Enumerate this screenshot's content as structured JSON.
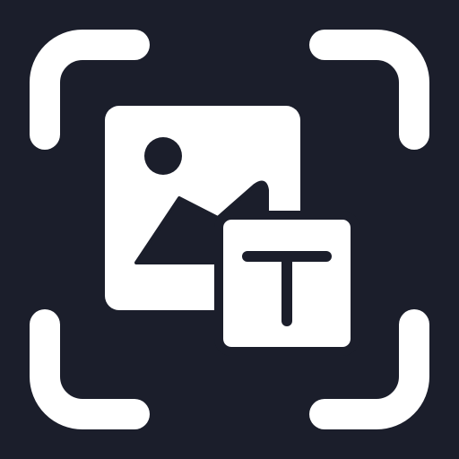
{
  "icon": {
    "background_color": "#1b1e2b",
    "foreground_color": "#ffffff",
    "glyphs": [
      "scan-frame-icon",
      "image-icon",
      "text-t-icon"
    ]
  }
}
